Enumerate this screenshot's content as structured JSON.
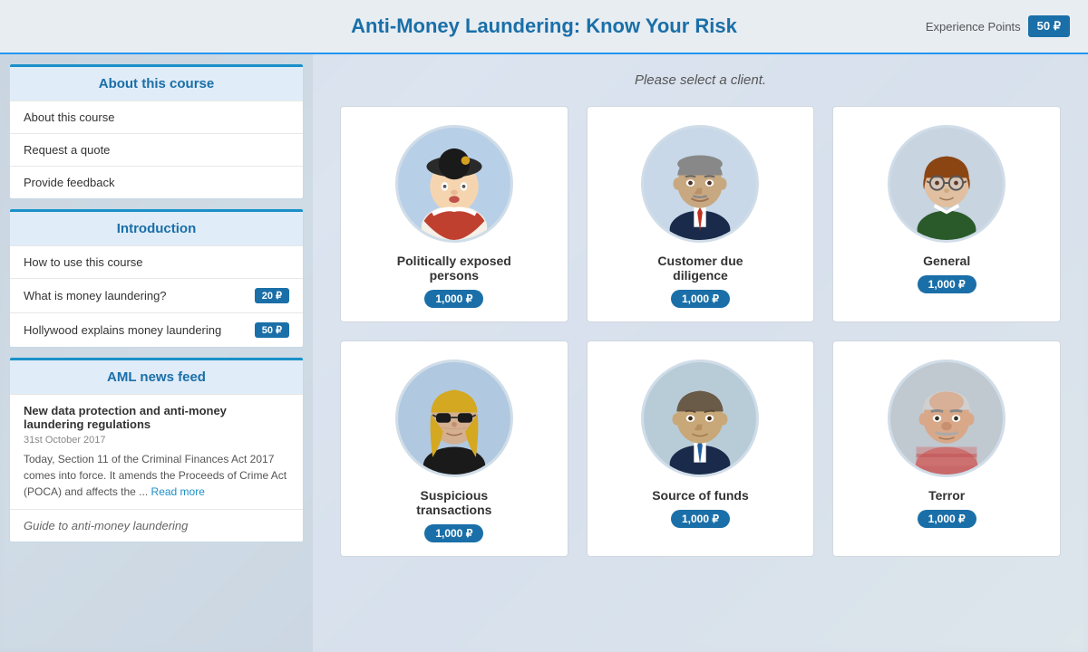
{
  "topBar": {
    "experienceLabel": "Experience Points",
    "experienceValue": "50 ₽",
    "pageTitle": "Anti-Money Laundering: Know Your Risk"
  },
  "sidebar": {
    "sections": [
      {
        "id": "about",
        "header": "About this course",
        "items": [
          {
            "label": "About this course",
            "points": null
          },
          {
            "label": "Request a quote",
            "points": null
          },
          {
            "label": "Provide feedback",
            "points": null
          }
        ]
      },
      {
        "id": "intro",
        "header": "Introduction",
        "items": [
          {
            "label": "How to use this course",
            "points": null
          },
          {
            "label": "What is money laundering?",
            "points": "20 ₽"
          },
          {
            "label": "Hollywood explains money laundering",
            "points": "50 ₽"
          }
        ]
      },
      {
        "id": "news",
        "header": "AML news feed",
        "newsItems": [
          {
            "title": "New data protection and anti-money laundering regulations",
            "date": "31st October 2017",
            "text": "Today, Section 11 of the Criminal Finances Act 2017 comes into force. It amends the Proceeds of Crime Act (POCA) and affects the ...",
            "readMore": "Read more"
          }
        ],
        "guideItem": "Guide to anti-money laundering"
      }
    ]
  },
  "content": {
    "prompt": "Please select a client.",
    "clients": [
      {
        "id": "pep",
        "name": "Politically exposed\npersons",
        "points": "1,000 ₽",
        "avatarColor": "#b8cfe8",
        "skinTone": "#f5d5b0"
      },
      {
        "id": "cdd",
        "name": "Customer due\ndiligence",
        "points": "1,000 ₽",
        "avatarColor": "#c8d8e8",
        "skinTone": "#c8a880"
      },
      {
        "id": "general",
        "name": "General",
        "points": "1,000 ₽",
        "avatarColor": "#c8d4e0",
        "skinTone": "#e0c0a0"
      },
      {
        "id": "suspicious",
        "name": "Suspicious\ntransactions",
        "points": "1,000 ₽",
        "avatarColor": "#b0c8e0",
        "skinTone": "#d4b090"
      },
      {
        "id": "source",
        "name": "Source of funds",
        "points": "1,000 ₽",
        "avatarColor": "#b8ccd8",
        "skinTone": "#c8a878"
      },
      {
        "id": "terror",
        "name": "Terror",
        "points": "1,000 ₽",
        "avatarColor": "#c0c8d0",
        "skinTone": "#d8a888"
      }
    ]
  }
}
